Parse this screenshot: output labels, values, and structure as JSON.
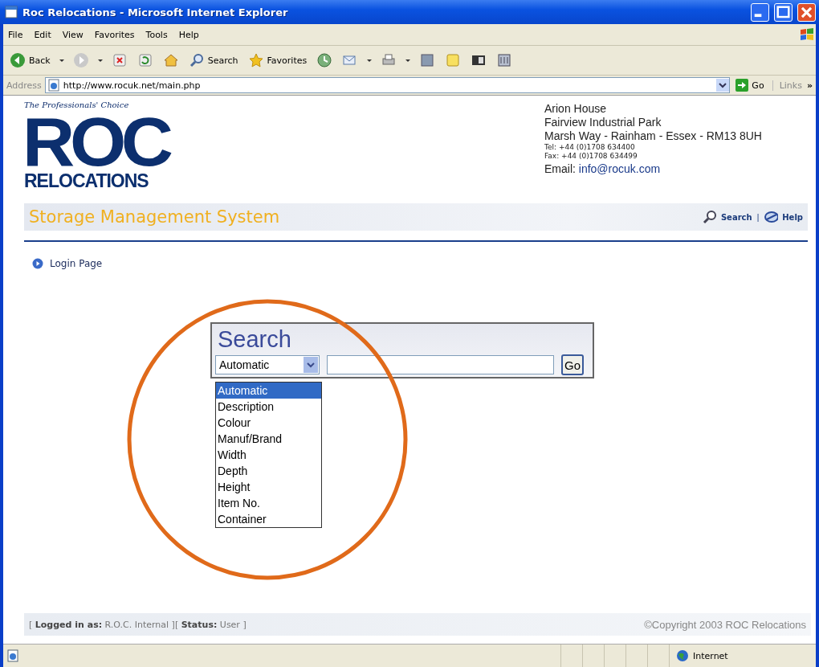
{
  "window": {
    "title": "Roc Relocations - Microsoft Internet Explorer"
  },
  "menu": [
    "File",
    "Edit",
    "View",
    "Favorites",
    "Tools",
    "Help"
  ],
  "toolbar": [
    {
      "kind": "back",
      "label": "Back"
    },
    {
      "kind": "forward"
    },
    {
      "kind": "stop"
    },
    {
      "kind": "refresh"
    },
    {
      "kind": "home"
    },
    {
      "kind": "search",
      "label": "Search"
    },
    {
      "kind": "favorites",
      "label": "Favorites"
    },
    {
      "kind": "history"
    },
    {
      "kind": "mail"
    },
    {
      "kind": "print"
    },
    {
      "kind": "edit"
    },
    {
      "kind": "note"
    },
    {
      "kind": "messenger"
    },
    {
      "kind": "research"
    }
  ],
  "address_bar": {
    "label": "Address",
    "url": "http://www.rocuk.net/main.php",
    "go": "Go",
    "links": "Links",
    "more": "»"
  },
  "logo": {
    "tagline": "The Professionals' Choice",
    "mark": "ROC",
    "name": "RELOCATIONS"
  },
  "contact": {
    "lines": [
      "Arion House",
      "Fairview Industrial Park",
      "Marsh Way - Rainham - Essex - RM13 8UH"
    ],
    "phones": [
      "Tel: +44 (0)1708 634400",
      "Fax: +44 (0)1708 634499"
    ],
    "email_label": "Email:",
    "email": "info@rocuk.com"
  },
  "system_bar": {
    "title": "Storage Management System",
    "links": [
      {
        "kind": "search",
        "label": "Search"
      },
      {
        "kind": "help",
        "label": "Help"
      }
    ],
    "separator": "|"
  },
  "breadcrumb": "Login Page",
  "search": {
    "title": "Search",
    "field": {
      "value": "Automatic",
      "expanded": true
    },
    "go": "Go",
    "options": [
      {
        "label": "Automatic",
        "selected": true
      },
      {
        "label": "Description",
        "selected": false
      },
      {
        "label": "Colour",
        "selected": false
      },
      {
        "label": "Manuf/Brand",
        "selected": false
      },
      {
        "label": "Width",
        "selected": false
      },
      {
        "label": "Depth",
        "selected": false
      },
      {
        "label": "Height",
        "selected": false
      },
      {
        "label": "Item No.",
        "selected": false
      },
      {
        "label": "Container",
        "selected": false
      }
    ]
  },
  "footer": {
    "session": "[ **Logged in as:** R.O.C. Internal ][ **Status:** User ]",
    "copyright": "©Copyright 2003 ROC Relocations"
  },
  "status_bar": {
    "zone": "Internet"
  }
}
